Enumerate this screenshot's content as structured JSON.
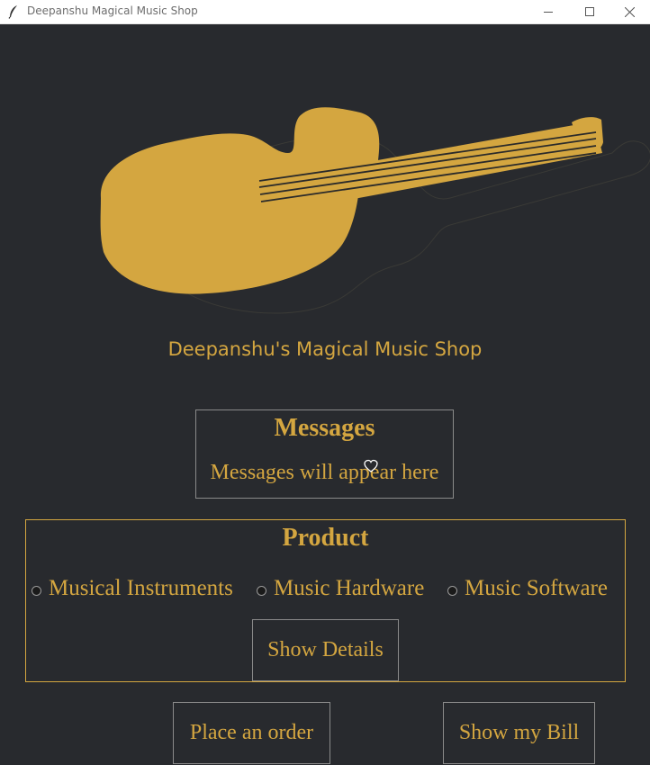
{
  "window": {
    "title": "Deepanshu Magical Music Shop"
  },
  "header": {
    "shop_title": "Deepanshu's Magical Music Shop"
  },
  "messages": {
    "heading": "Messages",
    "text": "Messages will appear here"
  },
  "product": {
    "heading": "Product",
    "options": [
      {
        "label": "Musical Instruments"
      },
      {
        "label": "Music Hardware"
      },
      {
        "label": "Music Software"
      }
    ],
    "show_details_label": "Show Details"
  },
  "actions": {
    "place_order_label": "Place an order",
    "show_bill_label": "Show my Bill"
  },
  "colors": {
    "background": "#282a2e",
    "accent": "#d4a640"
  }
}
